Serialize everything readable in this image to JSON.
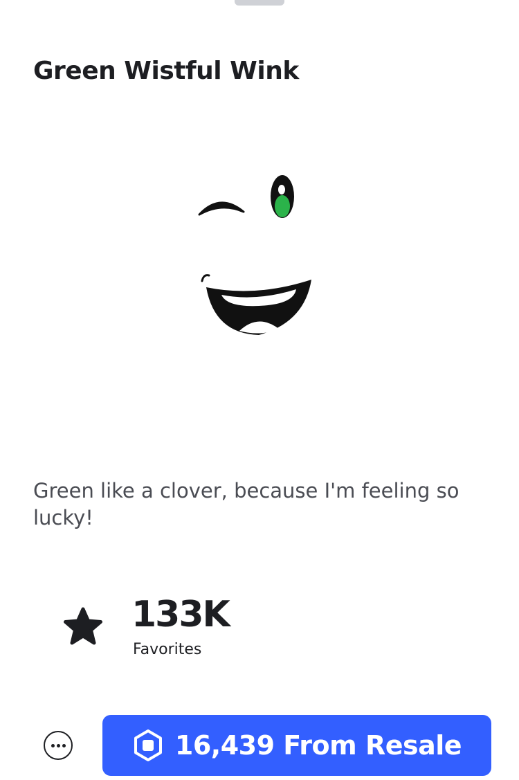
{
  "item": {
    "title": "Green Wistful Wink",
    "description": "Green like a clover, because I'm feeling so lucky!"
  },
  "favorites": {
    "count": "133K",
    "label": "Favorites"
  },
  "actions": {
    "buy_label": "16,439 From Resale"
  },
  "colors": {
    "accent": "#335fff",
    "eye_green": "#2bb34a"
  },
  "icons": {
    "favorite": "star-icon",
    "more": "more-options-icon",
    "currency": "robux-icon"
  }
}
